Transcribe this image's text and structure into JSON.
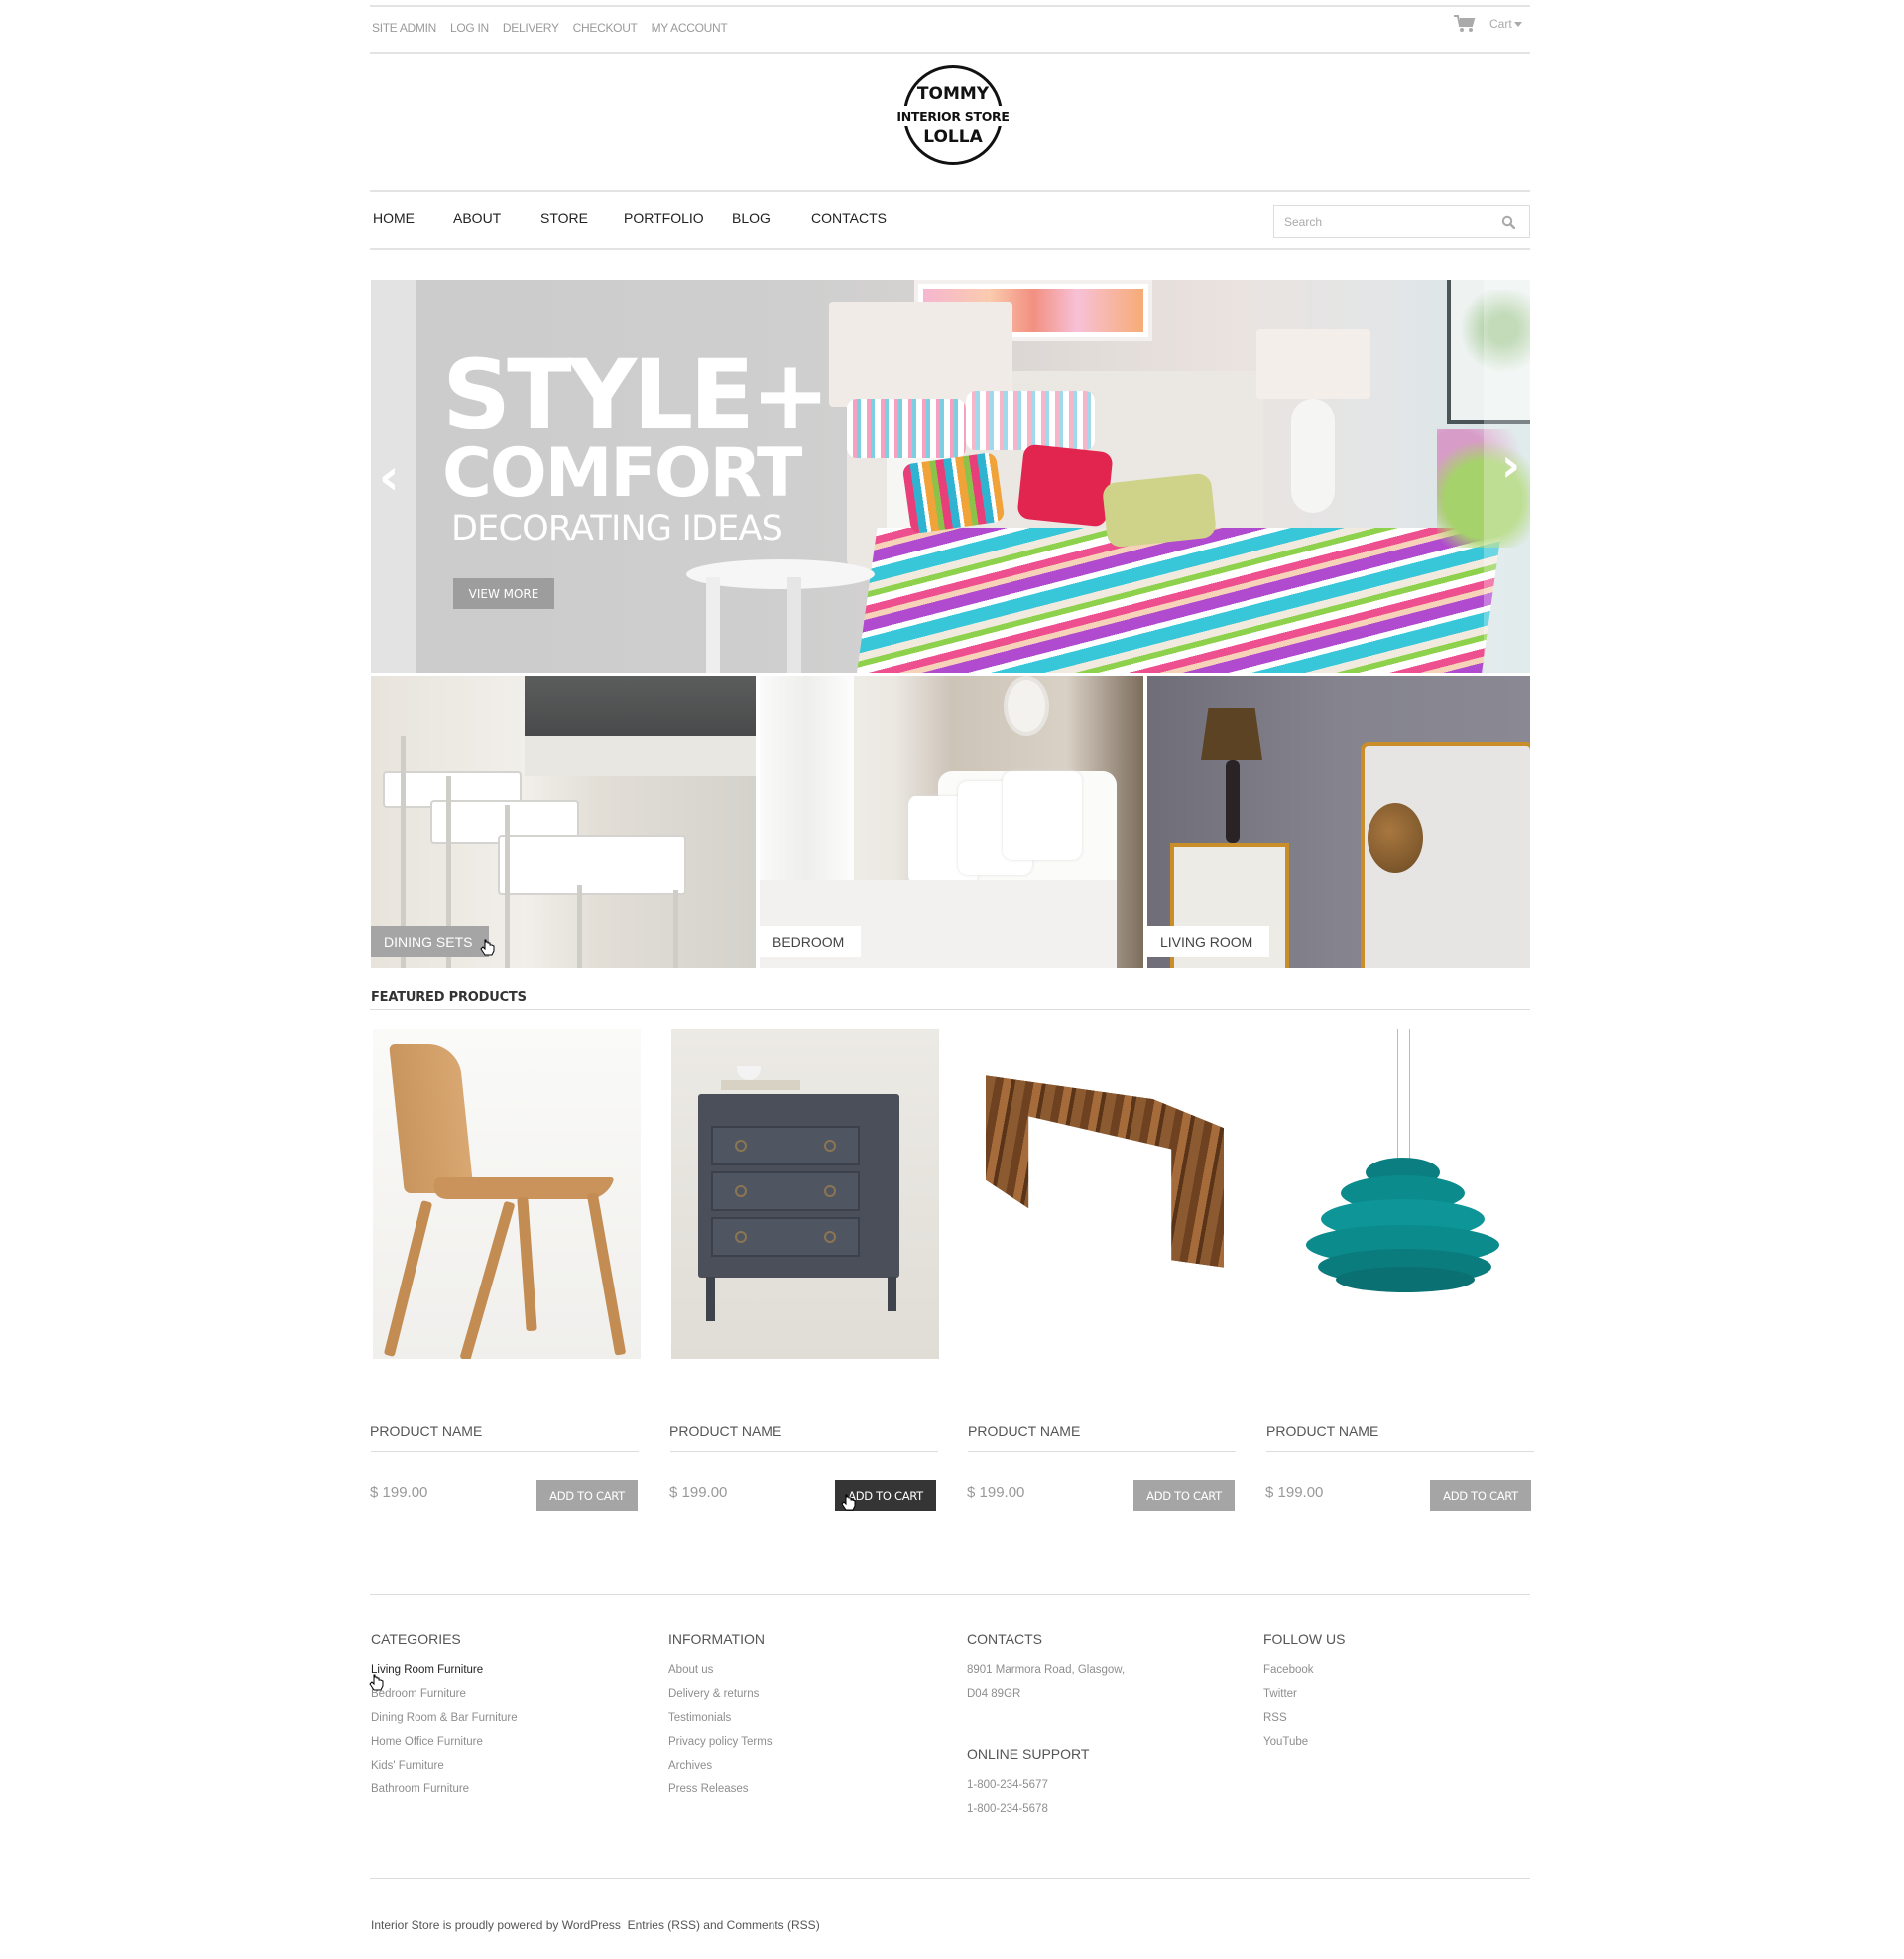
{
  "topbar": {
    "links": [
      "SITE ADMIN",
      "LOG IN",
      "DELIVERY",
      "CHECKOUT",
      "MY ACCOUNT"
    ],
    "cart_label": "Cart",
    "cart_icon": "shopping-cart-icon"
  },
  "logo": {
    "line1": "TOMMY",
    "line2": "INTERIOR STORE",
    "line3": "LOLLA"
  },
  "nav": {
    "items": [
      "HOME",
      "ABOUT",
      "STORE",
      "PORTFOLIO",
      "BLOG",
      "CONTACTS"
    ]
  },
  "search": {
    "placeholder": "Search",
    "value": "",
    "icon": "search-icon"
  },
  "slider": {
    "headline1": "STYLE+",
    "headline2": "COMFORT",
    "subheadline": "DECORATING IDEAS",
    "button_label": "VIEW MORE",
    "prev_icon": "‹",
    "next_icon": "›"
  },
  "categories_tiles": [
    {
      "label": "DINING SETS",
      "active": true
    },
    {
      "label": "BEDROOM",
      "active": false
    },
    {
      "label": "LIVING ROOM",
      "active": false
    }
  ],
  "featured": {
    "title": "FEATURED PRODUCTS",
    "products": [
      {
        "name": "PRODUCT NAME",
        "price": "$ 199.00",
        "button": "ADD TO CART",
        "image": "wooden chair",
        "hovered": false
      },
      {
        "name": "PRODUCT NAME",
        "price": "$ 199.00",
        "button": "ADD TO CART",
        "image": "grey dresser",
        "hovered": true
      },
      {
        "name": "PRODUCT NAME",
        "price": "$ 199.00",
        "button": "ADD TO CART",
        "image": "walnut side table",
        "hovered": false
      },
      {
        "name": "PRODUCT NAME",
        "price": "$ 199.00",
        "button": "ADD TO CART",
        "image": "teal pendant lamp",
        "hovered": false
      }
    ]
  },
  "footer": {
    "categories": {
      "title": "CATEGORIES",
      "items": [
        "Living Room Furniture",
        "Bedroom Furniture",
        "Dining Room & Bar Furniture",
        "Home Office Furniture",
        "Kids' Furniture",
        "Bathroom Furniture"
      ]
    },
    "information": {
      "title": "INFORMATION",
      "items": [
        "About us",
        "Delivery & returns",
        "Testimonials",
        "Privacy policy Terms",
        "Archives",
        "Press Releases"
      ]
    },
    "contacts": {
      "title": "CONTACTS",
      "address_line1": "8901 Marmora Road, Glasgow,",
      "address_line2": "D04 89GR",
      "support_title": "ONLINE SUPPORT",
      "phones": [
        "1-800-234-5677",
        "1-800-234-5678"
      ]
    },
    "follow": {
      "title": "FOLLOW US",
      "items": [
        "Facebook",
        "Twitter",
        "RSS",
        "YouTube"
      ]
    },
    "copyright": {
      "prefix": "Interior Store is proudly powered by",
      "wordpress": "WordPress",
      "entries": "Entries (RSS)",
      "and": "and",
      "comments": "Comments (RSS)"
    }
  }
}
